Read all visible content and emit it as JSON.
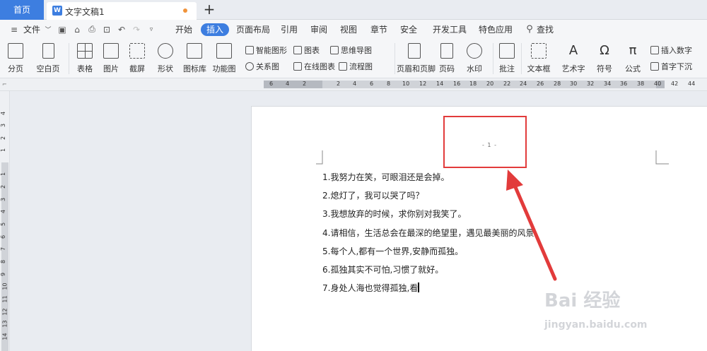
{
  "tabs": {
    "home": "首页",
    "doc_title": "文字文稿1",
    "new_tab": "+"
  },
  "menubar": {
    "file": "文件",
    "tabs": [
      "开始",
      "插入",
      "页面布局",
      "引用",
      "审阅",
      "视图",
      "章节",
      "安全",
      "开发工具",
      "特色应用"
    ],
    "active": "插入",
    "search": "查找"
  },
  "ribbon": {
    "big": [
      "分页",
      "空白页",
      "表格",
      "图片",
      "截屏",
      "形状",
      "图标库",
      "功能图",
      "页眉和页脚",
      "页码",
      "水印",
      "批注",
      "文本框",
      "艺术字",
      "符号",
      "公式"
    ],
    "small": [
      "智能图形",
      "图表",
      "思维导图",
      "关系图",
      "在线图表",
      "流程图",
      "插入数字",
      "首字下沉"
    ]
  },
  "ruler": {
    "h_left": [
      "6",
      "4",
      "2"
    ],
    "h_right": [
      "2",
      "4",
      "6",
      "8",
      "10",
      "12",
      "14",
      "16",
      "18",
      "20",
      "22",
      "24",
      "26",
      "28",
      "30",
      "32",
      "34",
      "36",
      "38",
      "40",
      "42",
      "44"
    ],
    "v_top": [
      "4",
      "3",
      "2",
      "1"
    ],
    "v_bottom": [
      "1",
      "2",
      "3",
      "4",
      "5",
      "6",
      "7",
      "8",
      "9",
      "10",
      "11",
      "12",
      "13",
      "14"
    ]
  },
  "document": {
    "page_number": "- 1 -",
    "lines": [
      "1.我努力在笑，可眼泪还是会掉。",
      "2.熄灯了，我可以哭了吗？",
      "3.我想放弃的时候，求你别对我笑了。",
      "4.请相信，生活总会在最深的绝望里，遇见最美丽的风景。",
      "5.每个人,都有一个世界,安静而孤独。",
      "6.孤独其实不可怕,习惯了就好。",
      "7.身处人海也觉得孤独,看"
    ]
  },
  "annotation": {
    "color": "#e23b3b"
  },
  "watermark": {
    "brand": "Bai 经验",
    "url": "jingyan.baidu.com"
  },
  "colors": {
    "accent": "#3d7ee0"
  }
}
